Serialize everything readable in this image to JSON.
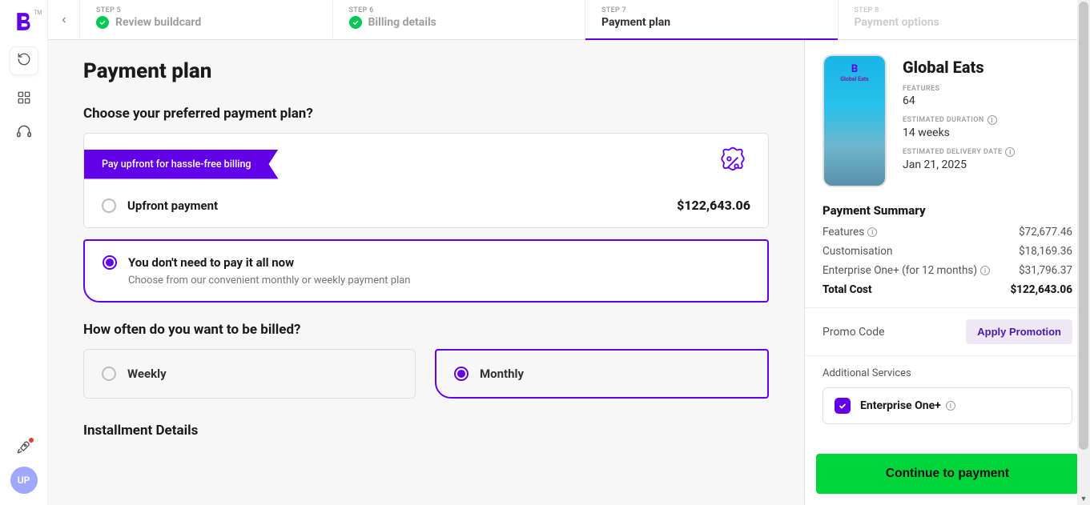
{
  "rail": {
    "tm": "TM",
    "avatar_initials": "UP"
  },
  "stepper": {
    "steps": [
      {
        "num": "STEP 5",
        "title": "Review buildcard",
        "done": true
      },
      {
        "num": "STEP 6",
        "title": "Billing details",
        "done": true
      },
      {
        "num": "STEP 7",
        "title": "Payment plan",
        "active": true
      },
      {
        "num": "STEP 8",
        "title": "Payment options",
        "disabled": true
      }
    ]
  },
  "content": {
    "heading": "Payment plan",
    "choose_label": "Choose your preferred payment plan?",
    "ribbon": "Pay upfront for hassle-free billing",
    "upfront_label": "Upfront payment",
    "upfront_price": "$122,643.06",
    "installment_title": "You don't need to pay it all now",
    "installment_sub": "Choose from our convenient monthly or weekly payment plan",
    "billing_label": "How often do you want to be billed?",
    "weekly": "Weekly",
    "monthly": "Monthly",
    "details_heading": "Installment Details"
  },
  "summary": {
    "product_name": "Global Eats",
    "phone_app_name": "Global Eats",
    "features_label": "FEATURES",
    "features_val": "64",
    "duration_label": "ESTIMATED DURATION",
    "duration_val": "14 weeks",
    "delivery_label": "ESTIMATED DELIVERY DATE",
    "delivery_val": "Jan 21, 2025",
    "summary_heading": "Payment Summary",
    "rows": [
      {
        "label": "Features",
        "info": true,
        "value": "$72,677.46"
      },
      {
        "label": "Customisation",
        "info": false,
        "value": "$18,169.36"
      },
      {
        "label": "Enterprise One+ (for 12 months)",
        "info": true,
        "value": "$31,796.37"
      }
    ],
    "total_label": "Total Cost",
    "total_value": "$122,643.06",
    "promo_label": "Promo Code",
    "promo_cta": "Apply Promotion",
    "addon_label": "Additional Services",
    "addon_name": "Enterprise One+",
    "cta": "Continue to payment"
  }
}
